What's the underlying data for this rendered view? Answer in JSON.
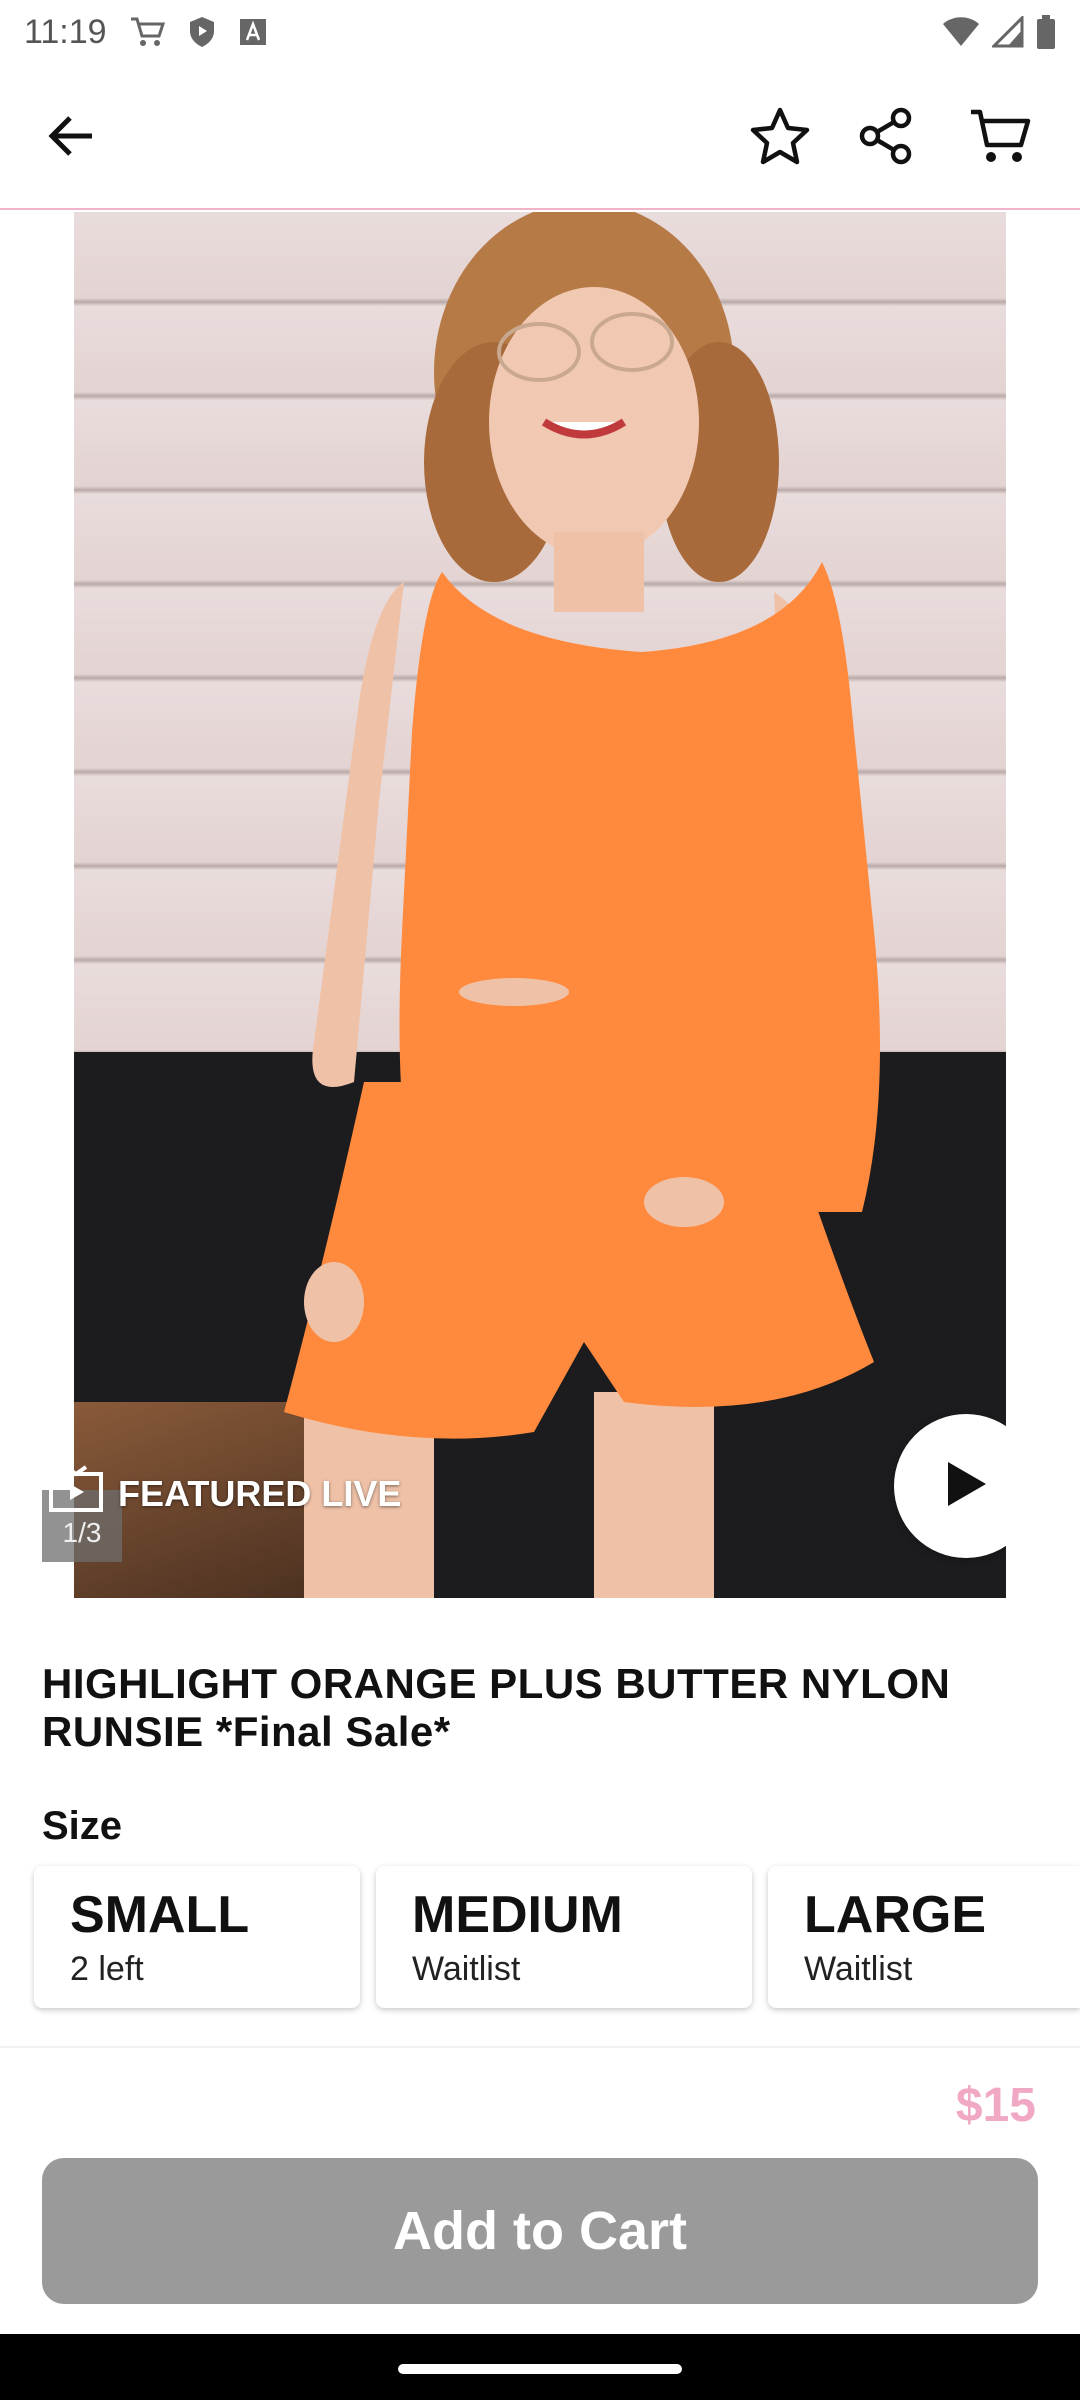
{
  "status_bar": {
    "time": "11:19",
    "icons": [
      "cart-notification-icon",
      "shield-play-icon",
      "a-box-icon",
      "wifi-icon",
      "signal-icon",
      "battery-icon"
    ]
  },
  "top_bar": {
    "icons": [
      "back-arrow-icon",
      "star-outline-icon",
      "share-icon",
      "cart-icon"
    ]
  },
  "gallery": {
    "badge_text": "FEATURED LIVE",
    "page_counter": "1/3"
  },
  "product": {
    "title": "HIGHLIGHT ORANGE PLUS BUTTER NYLON RUNSIE *Final Sale*",
    "size_label": "Size",
    "sizes": [
      {
        "name": "SMALL",
        "stock": "2 left"
      },
      {
        "name": "MEDIUM",
        "stock": "Waitlist"
      },
      {
        "name": "LARGE",
        "stock": "Waitlist"
      }
    ],
    "price": "$15"
  },
  "actions": {
    "add_to_cart_label": "Add to Cart"
  },
  "colors": {
    "accent_pink": "#f0a8c4",
    "divider_pink": "#f1b3c9",
    "button_gray": "#9a9a9a",
    "garment_orange": "#ff8a3d"
  }
}
